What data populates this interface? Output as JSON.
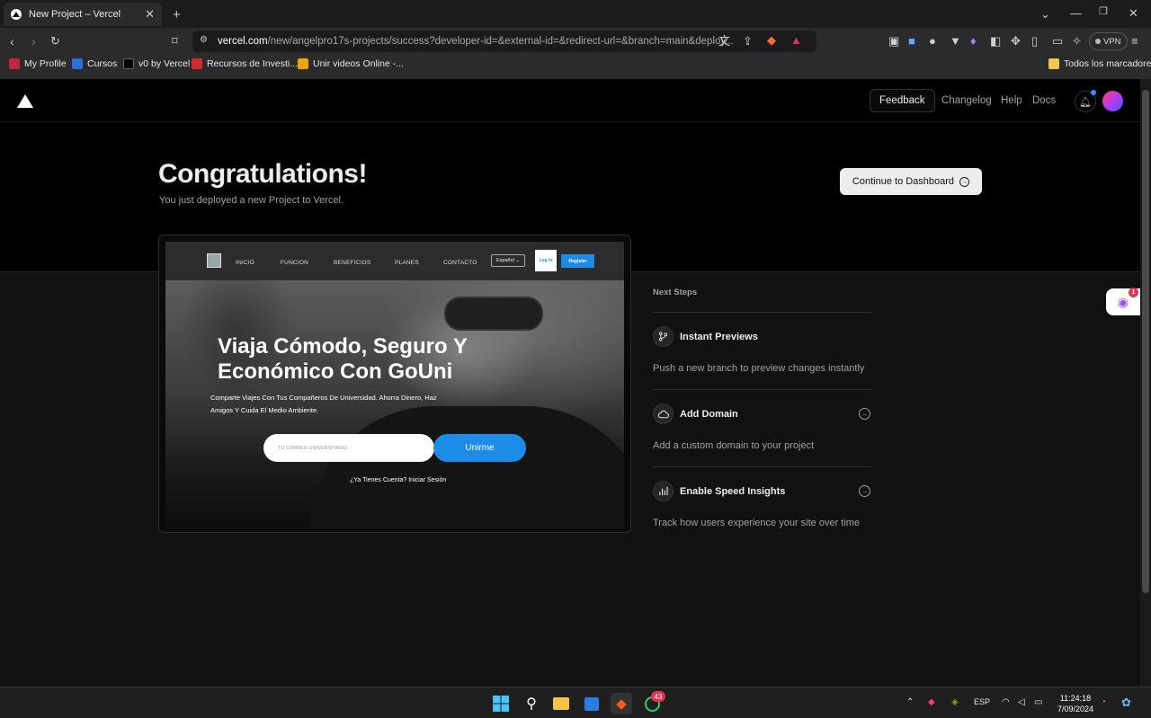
{
  "browser": {
    "tab_title": "New Project – Vercel",
    "tab_close": "✕",
    "new_tab": "+",
    "url_host": "vercel.com",
    "url_path": "/new/angelpro17s-projects/success?developer-id=&external-id=&redirect-url=&branch=main&deploy...",
    "vpn_label": "VPN",
    "bookmarks": [
      "My Profile",
      "Cursos",
      "v0 by Vercel",
      "Recursos de Investi...",
      "Unir videos Online -..."
    ],
    "all_bookmarks": "Todos los marcadores"
  },
  "nav": {
    "feedback": "Feedback",
    "changelog": "Changelog",
    "help": "Help",
    "docs": "Docs"
  },
  "hero": {
    "title": "Congratulations!",
    "subtitle": "You just deployed a new Project to Vercel.",
    "dashboard_button": "Continue to Dashboard"
  },
  "preview": {
    "nav_links": [
      "INICIO",
      "FUNCION",
      "BENEFICIOS",
      "PLANES",
      "CONTACTO"
    ],
    "language": "Español",
    "login": "Log In",
    "register": "Register",
    "headline": "Viaja Cómodo, Seguro Y Económico Con GoUni",
    "description": "Comparte Viajes Con Tus Compañeros De Universidad. Ahorra Dinero, Haz Amigos Y Cuida El Medio Ambiente.",
    "email_placeholder": "TU CORREO UNIVERSITARIO",
    "join_button": "Unirme",
    "account_link": "¿Ya Tienes Cuenta? Iniciar Sesión"
  },
  "next_steps": {
    "title": "Next Steps",
    "items": [
      {
        "label": "Instant Previews",
        "description": "Push a new branch to preview changes instantly",
        "icon": "git-branch-icon"
      },
      {
        "label": "Add Domain",
        "description": "Add a custom domain to your project",
        "icon": "cloud-icon"
      },
      {
        "label": "Enable Speed Insights",
        "description": "Track how users experience your site over time",
        "icon": "bar-chart-icon"
      }
    ]
  },
  "extension_badge": "1",
  "taskbar": {
    "whatsapp_badge": "43",
    "lang": "ESP",
    "time": "11:24:18",
    "date": "7/09/2024"
  },
  "colors": {
    "accent_blue": "#1d8ce8",
    "page_bg": "#111111",
    "hero_bg": "#000000"
  }
}
